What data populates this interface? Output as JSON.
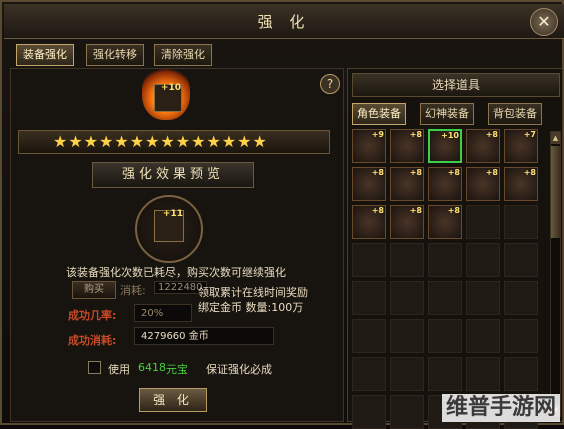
{
  "window": {
    "title": "强 化",
    "close_glyph": "✕"
  },
  "tabs": [
    "装备强化",
    "强化转移",
    "清除强化"
  ],
  "main_item": {
    "level": "+10"
  },
  "stars": "★★★★★★★★★★★★★★",
  "preview": {
    "banner": "强化效果预览",
    "level": "+11"
  },
  "info_text": "该装备强化次数已耗尽，购买次数可继续强化",
  "buy": {
    "button": "购买",
    "cost_label": "消耗:",
    "cost_value": "1222480",
    "reward_line1": "领取累计在线时间奖励",
    "reward_line2": "绑定金币 数量:100万"
  },
  "success_rate": {
    "label": "成功几率:",
    "value": "20%"
  },
  "success_cost": {
    "label": "成功消耗:",
    "value": "4279660 金币"
  },
  "guarantee": {
    "use": "使用",
    "amount": "6418",
    "currency": "元宝",
    "desc": "保证强化必成"
  },
  "enhance_button": "强 化",
  "right": {
    "title": "选择道具",
    "tabs": [
      "角色装备",
      "幻神装备",
      "背包装备"
    ],
    "items": [
      {
        "plus": "+9"
      },
      {
        "plus": "+8"
      },
      {
        "plus": "+10"
      },
      {
        "plus": "+8"
      },
      {
        "plus": "+7"
      },
      {
        "plus": "+8"
      },
      {
        "plus": "+8"
      },
      {
        "plus": "+8"
      },
      {
        "plus": "+8"
      },
      {
        "plus": "+8"
      },
      {
        "plus": "+8"
      },
      {
        "plus": "+8"
      },
      {
        "plus": "+8"
      }
    ]
  },
  "watermark": "维普手游网"
}
